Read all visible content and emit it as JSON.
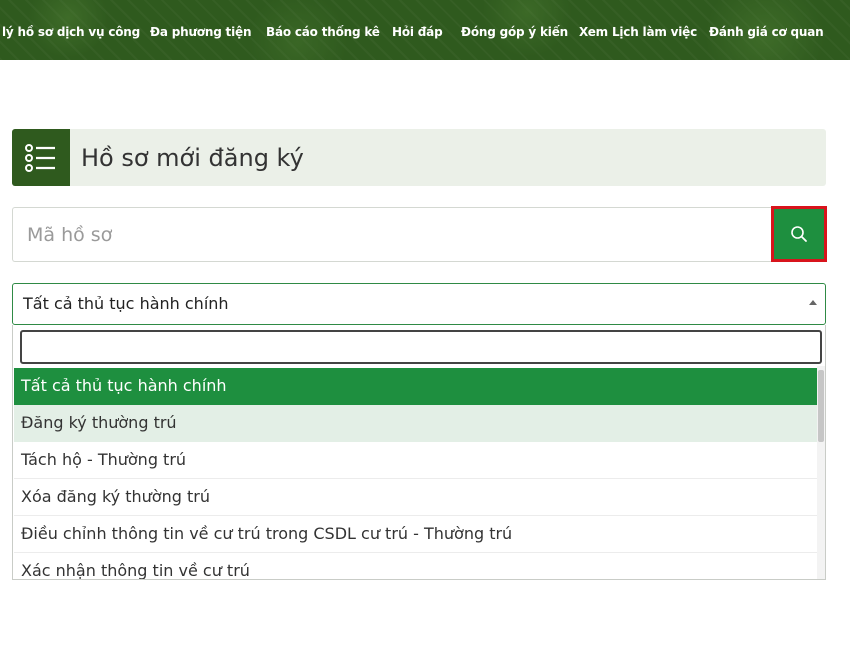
{
  "nav": {
    "items": [
      "lý hồ sơ dịch vụ công",
      "Đa phương tiện",
      "Báo cáo thống kê",
      "Hỏi đáp",
      "Đóng góp ý kiến",
      "Xem Lịch làm việc",
      "Đánh giá cơ quan"
    ]
  },
  "panel": {
    "title": "Hồ sơ mới đăng ký",
    "icon": "list-icon"
  },
  "search": {
    "placeholder": "Mã hồ sơ",
    "value": "",
    "button_icon": "search-icon"
  },
  "select": {
    "value": "Tất cả thủ tục hành chính",
    "search_value": "",
    "options": [
      "Tất cả thủ tục hành chính",
      "Đăng ký thường trú",
      "Tách hộ - Thường trú",
      "Xóa đăng ký thường trú",
      "Điều chỉnh thông tin về cư trú trong CSDL cư trú - Thường trú",
      "Xác nhận thông tin về cư trú"
    ],
    "selected_index": 0,
    "hover_index": 1
  },
  "colors": {
    "nav_bg": "#2f5a1e",
    "accent_green": "#1e8f3f",
    "highlight_border": "#d8141c",
    "header_bg": "#ebf0e8"
  }
}
